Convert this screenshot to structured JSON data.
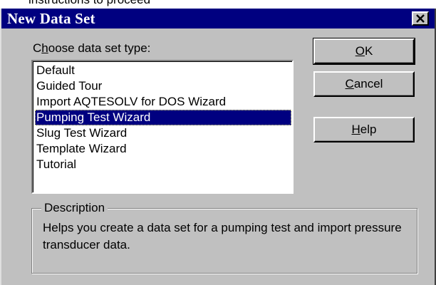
{
  "top_fragment": "instructions to proceed",
  "dialog": {
    "title": "New Data Set",
    "close_symbol": "×"
  },
  "choose_label": {
    "before": "C",
    "accel": "h",
    "after": "oose data set type:"
  },
  "list": {
    "items": [
      "Default",
      "Guided Tour",
      "Import AQTESOLV for DOS Wizard",
      "Pumping Test Wizard",
      "Slug Test Wizard",
      "Template Wizard",
      "Tutorial"
    ],
    "selected": "Pumping Test Wizard"
  },
  "buttons": {
    "ok": {
      "accel": "O",
      "rest": "K"
    },
    "cancel": {
      "accel": "C",
      "rest": "ancel"
    },
    "help": {
      "accel": "H",
      "rest": "elp"
    }
  },
  "description": {
    "legend": "Description",
    "text": "Helps you create a data set for a pumping test and import pressure transducer data."
  },
  "colors": {
    "titlebar": "#000080",
    "face": "#c0c0c0",
    "selection": "#000080"
  }
}
